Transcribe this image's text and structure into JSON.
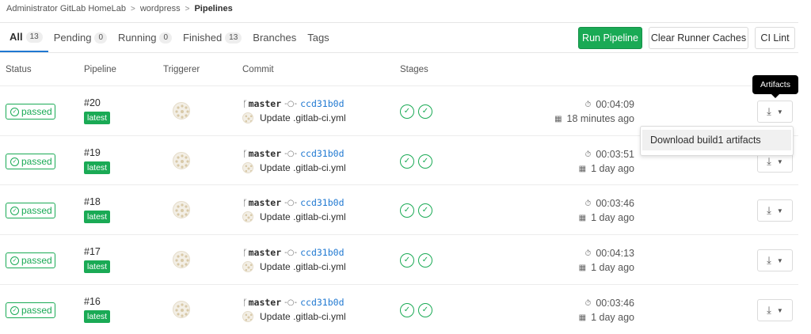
{
  "breadcrumb": [
    "Administrator GitLab HomeLab",
    "wordpress",
    "Pipelines"
  ],
  "tabs": [
    {
      "label": "All",
      "count": "13"
    },
    {
      "label": "Pending",
      "count": "0"
    },
    {
      "label": "Running",
      "count": "0"
    },
    {
      "label": "Finished",
      "count": "13"
    },
    {
      "label": "Branches"
    },
    {
      "label": "Tags"
    }
  ],
  "actions": {
    "run_pipeline": "Run Pipeline",
    "clear_caches": "Clear Runner Caches",
    "ci_lint": "CI Lint"
  },
  "columns": {
    "status": "Status",
    "pipeline": "Pipeline",
    "triggerer": "Triggerer",
    "commit": "Commit",
    "stages": "Stages"
  },
  "icons": {
    "status": "check-circle-icon",
    "branch": "branch-icon",
    "commit": "commit-icon",
    "duration": "timer-icon",
    "calendar": "calendar-icon",
    "download": "download-icon",
    "caret": "chevron-down-icon"
  },
  "colors": {
    "success": "#1aaa55",
    "link": "#1f78d1",
    "active_tab": "#1f78d1"
  },
  "pipelines": [
    {
      "status": "passed",
      "id": "#20",
      "tag": "latest",
      "branch": "master",
      "sha": "ccd31b0d",
      "message": "Update .gitlab-ci.yml",
      "duration": "00:04:09",
      "ago": "18 minutes ago"
    },
    {
      "status": "passed",
      "id": "#19",
      "tag": "latest",
      "branch": "master",
      "sha": "ccd31b0d",
      "message": "Update .gitlab-ci.yml",
      "duration": "00:03:51",
      "ago": "1 day ago"
    },
    {
      "status": "passed",
      "id": "#18",
      "tag": "latest",
      "branch": "master",
      "sha": "ccd31b0d",
      "message": "Update .gitlab-ci.yml",
      "duration": "00:03:46",
      "ago": "1 day ago"
    },
    {
      "status": "passed",
      "id": "#17",
      "tag": "latest",
      "branch": "master",
      "sha": "ccd31b0d",
      "message": "Update .gitlab-ci.yml",
      "duration": "00:04:13",
      "ago": "1 day ago"
    },
    {
      "status": "passed",
      "id": "#16",
      "tag": "latest",
      "branch": "master",
      "sha": "ccd31b0d",
      "message": "Update .gitlab-ci.yml",
      "duration": "00:03:46",
      "ago": "1 day ago"
    }
  ],
  "tooltip": "Artifacts",
  "artifacts_dropdown": {
    "item": "Download build1 artifacts"
  }
}
